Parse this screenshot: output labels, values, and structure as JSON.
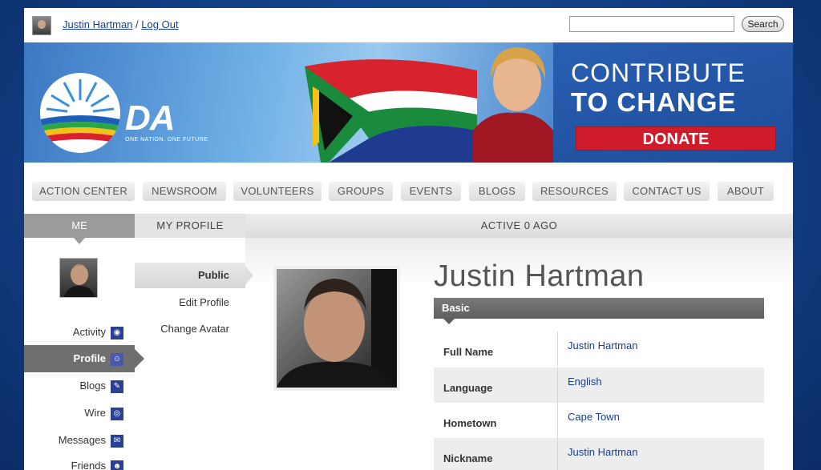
{
  "topbar": {
    "user_link": "Justin Hartman",
    "separator": "/",
    "logout_link": "Log Out",
    "search_value": "",
    "search_button": "Search"
  },
  "banner": {
    "logo_text": "DA",
    "logo_tagline": "ONE NATION. ONE FUTURE",
    "contribute_line1": "CONTRIBUTE",
    "contribute_line2": "TO CHANGE",
    "donate_button": "DONATE"
  },
  "nav": {
    "items": [
      "ACTION CENTER",
      "NEWSROOM",
      "VOLUNTEERS",
      "GROUPS",
      "EVENTS",
      "BLOGS",
      "RESOURCES",
      "CONTACT US",
      "ABOUT"
    ]
  },
  "profile_header": {
    "me_tab": "ME",
    "my_profile_tab": "MY PROFILE",
    "active_status": "ACTIVE 0 AGO"
  },
  "left_nav": {
    "items": [
      {
        "label": "Activity",
        "icon": "rss-icon"
      },
      {
        "label": "Profile",
        "icon": "user-icon"
      },
      {
        "label": "Blogs",
        "icon": "edit-icon"
      },
      {
        "label": "Wire",
        "icon": "wire-icon"
      },
      {
        "label": "Messages",
        "icon": "envelope-icon"
      },
      {
        "label": "Friends",
        "icon": "smiley-icon"
      }
    ]
  },
  "sub_nav": {
    "items": [
      "Public",
      "Edit Profile",
      "Change Avatar"
    ]
  },
  "profile": {
    "name": "Justin Hartman",
    "section_title": "Basic",
    "fields": [
      {
        "label": "Full Name",
        "value": "Justin Hartman"
      },
      {
        "label": "Language",
        "value": "English"
      },
      {
        "label": "Hometown",
        "value": "Cape Town"
      },
      {
        "label": "Nickname",
        "value": "Justin Hartman"
      }
    ]
  },
  "colors": {
    "page_background": "#123f86",
    "donate_red": "#d01c2a",
    "link_blue": "#1a3f8f",
    "icon_blue": "#2b3f95"
  }
}
